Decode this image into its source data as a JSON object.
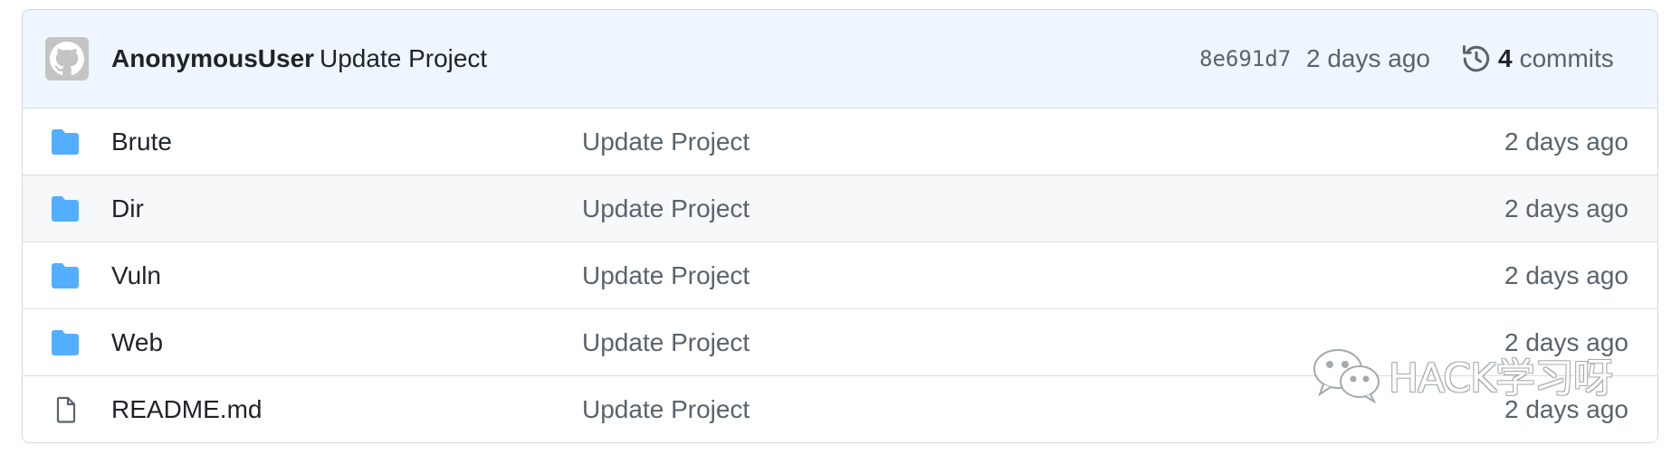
{
  "commit": {
    "author": "AnonymousUser",
    "message": "Update Project",
    "hash": "8e691d7",
    "date": "2 days ago",
    "commit_count": "4",
    "commits_label": "commits"
  },
  "files": [
    {
      "name": "Brute",
      "type": "folder",
      "message": "Update Project",
      "date": "2 days ago"
    },
    {
      "name": "Dir",
      "type": "folder",
      "message": "Update Project",
      "date": "2 days ago"
    },
    {
      "name": "Vuln",
      "type": "folder",
      "message": "Update Project",
      "date": "2 days ago"
    },
    {
      "name": "Web",
      "type": "folder",
      "message": "Update Project",
      "date": "2 days ago"
    },
    {
      "name": "README.md",
      "type": "file",
      "message": "Update Project",
      "date": "2 days ago"
    }
  ],
  "watermark": "HACK学习呀",
  "colors": {
    "folder": "#54aeff",
    "header_bg": "#f0f6ff",
    "hover_bg": "#f6f8fa"
  }
}
